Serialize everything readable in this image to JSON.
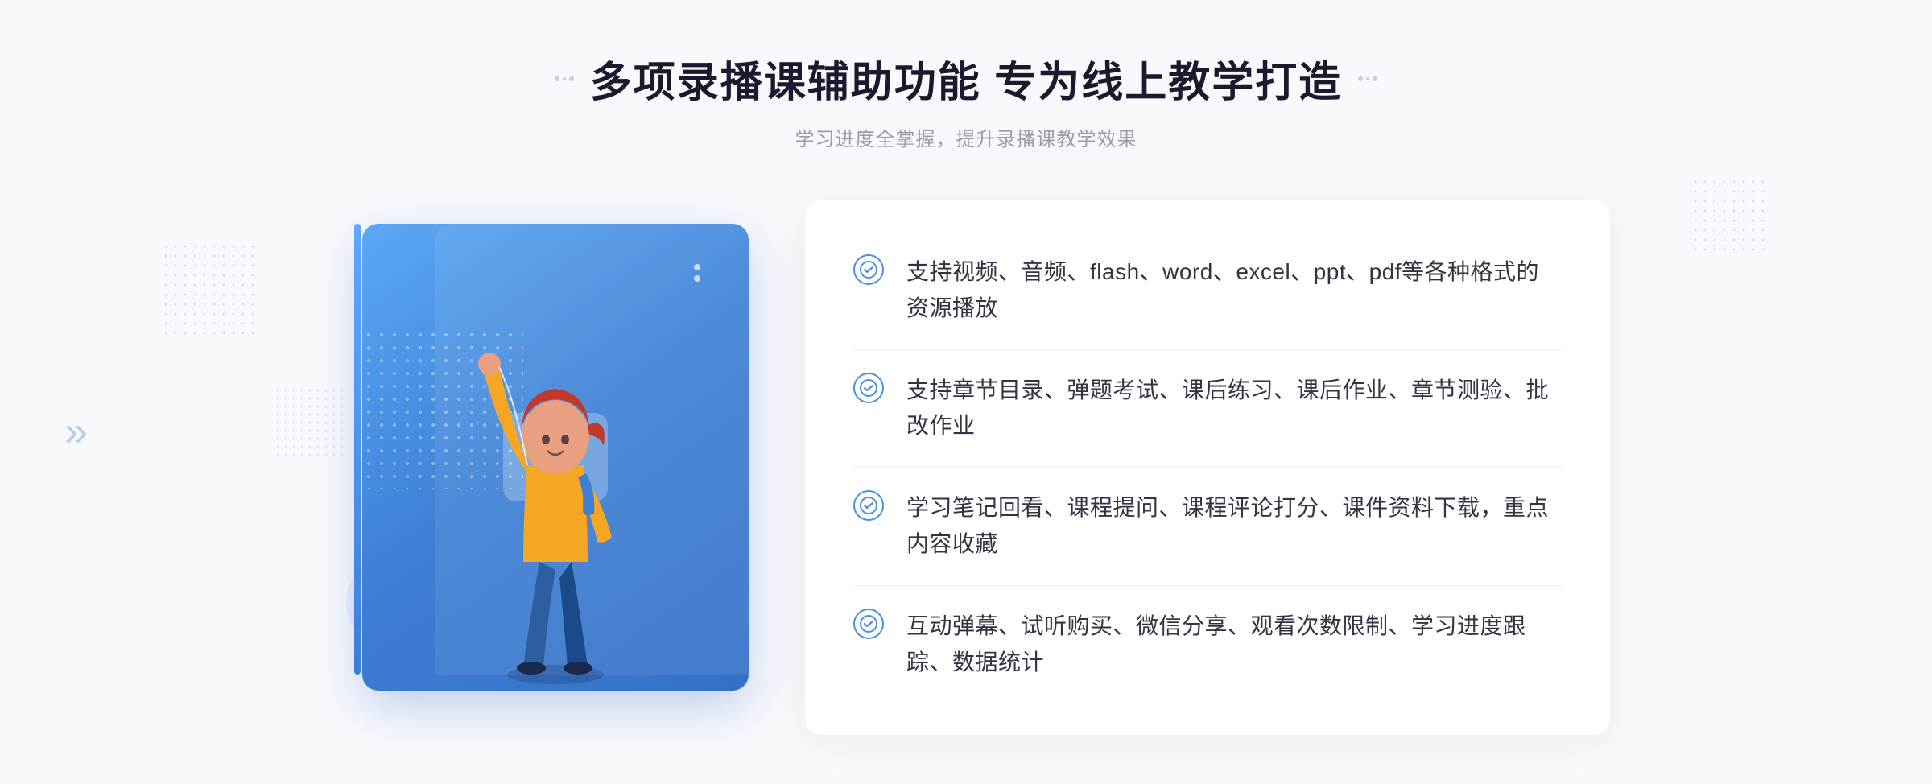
{
  "page": {
    "background": "#f8f9fc"
  },
  "header": {
    "title": "多项录播课辅助功能 专为线上教学打造",
    "subtitle": "学习进度全掌握，提升录播课教学效果",
    "title_decorator_left": "❖",
    "title_decorator_right": "❖"
  },
  "features": [
    {
      "id": 1,
      "text": "支持视频、音频、flash、word、excel、ppt、pdf等各种格式的资源播放"
    },
    {
      "id": 2,
      "text": "支持章节目录、弹题考试、课后练习、课后作业、章节测验、批改作业"
    },
    {
      "id": 3,
      "text": "学习笔记回看、课程提问、课程评论打分、课件资料下载，重点内容收藏"
    },
    {
      "id": 4,
      "text": "互动弹幕、试听购买、微信分享、观看次数限制、学习进度跟踪、数据统计"
    }
  ],
  "illustration": {
    "play_icon": "▶",
    "chevron_left": "»"
  }
}
